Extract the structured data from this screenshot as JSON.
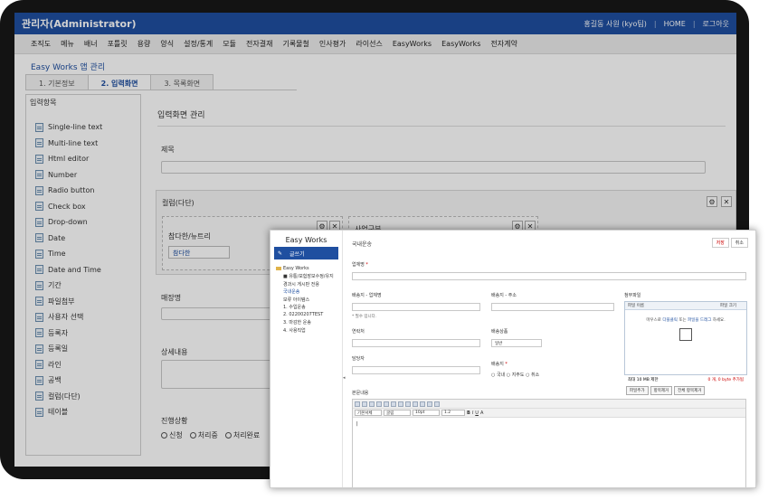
{
  "topbar": {
    "title": "관리자(Administrator)",
    "user": "홍길동 사원 (kyo팀)",
    "home": "HOME",
    "logout": "로그아웃"
  },
  "menu": [
    "조직도",
    "메뉴",
    "배너",
    "포틀릿",
    "용량",
    "양식",
    "설정/통계",
    "모듈",
    "전자결재",
    "기록물철",
    "인사평가",
    "라이선스",
    "EasyWorks",
    "EasyWorks",
    "전자계약"
  ],
  "app_title": "Easy Works 앱 관리",
  "tabs": [
    "1. 기본정보",
    "2. 입력화면",
    "3. 목록화면"
  ],
  "left_panel": {
    "title": "입력항목",
    "items": [
      "Single-line text",
      "Multi-line text",
      "Html editor",
      "Number",
      "Radio button",
      "Check box",
      "Drop-down",
      "Date",
      "Time",
      "Date and Time",
      "기간",
      "파일첨부",
      "사용자 선택",
      "등록자",
      "등록일",
      "라인",
      "공백",
      "컬럼(다단)",
      "테이블"
    ]
  },
  "right_panel": {
    "title": "입력화면 관리",
    "field_title": "제목",
    "column_title": "컬럼(다단)",
    "sub_col_label": "참다한/뉴트리",
    "sub_col_select": "참다한",
    "sub_col2_label": "사업구분",
    "field_store": "매장명",
    "field_detail": "상세내용",
    "field_status": "진행상황",
    "status_options": [
      "신청",
      "처리중",
      "처리완료"
    ]
  },
  "popup": {
    "brand": "Easy Works",
    "write_btn": "글쓰기",
    "tree": [
      "Easy Works",
      "■ 유통/보험장보수정/유지",
      "경과시 게시판 전용",
      "국내운송",
      "보류 아이템스",
      "1. 수입운송",
      "2. 02200207TEST",
      "3. 마감한 운송",
      "4. 사용직업"
    ],
    "title": "국내운송",
    "save_btn": "저장",
    "cancel_btn": "취소",
    "company_label": "업체명",
    "form": {
      "shipper_name": "배송지 - 업체명",
      "shipper_addr": "배송지 - 주소",
      "note": "* 필수 입니다.",
      "contact": "연락처",
      "product": "배송상품",
      "product_value": "일반",
      "manager": "담당자",
      "dest": "배송지",
      "dest_options": [
        "국내",
        "지주도",
        "취소"
      ],
      "body": "본문내용"
    },
    "file": {
      "title": "첨부파일",
      "col_name": "파일 이름",
      "col_size": "파일 크기",
      "drop_prefix": "마우스로",
      "drop_mid1": "다블클릭",
      "drop_mid2": "또는",
      "drop_mid3": "파일을 드래그",
      "drop_suffix": "하세요.",
      "max_size": "최대 10 MB 제한",
      "count": "0 개, 0 byte 추가됨",
      "btn_add": "파일추가",
      "btn_remove": "항목제거",
      "btn_remove_all": "전체 항목제거"
    },
    "editor": {
      "font": "기본서체",
      "family": "굴림",
      "size": "10pt",
      "line": "1.2"
    }
  }
}
